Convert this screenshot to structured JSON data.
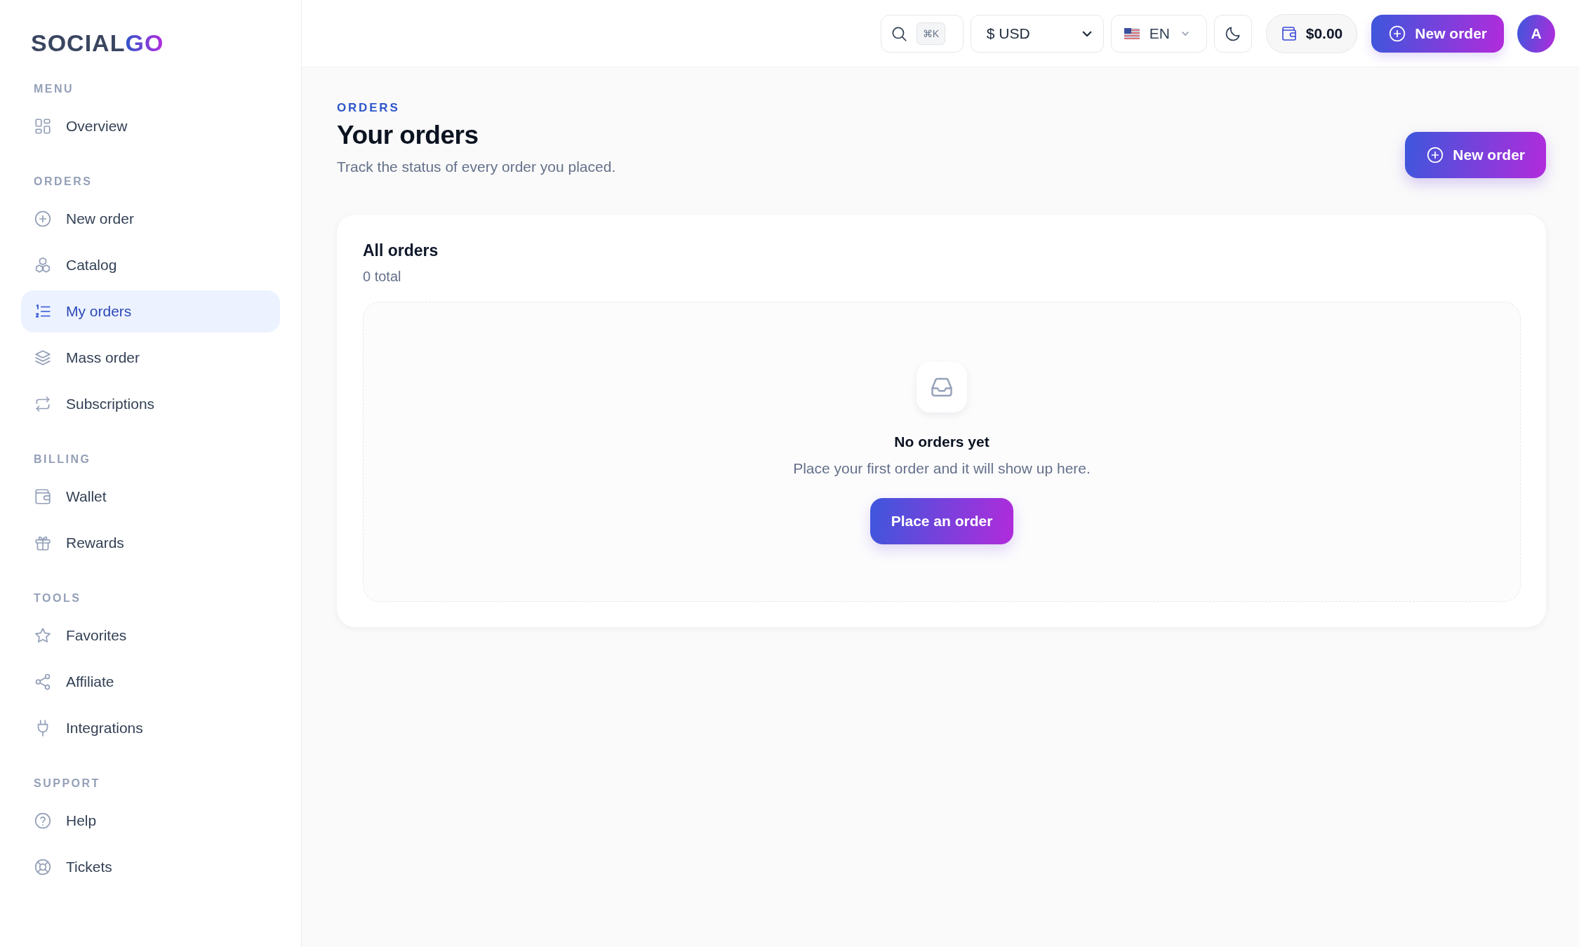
{
  "logo": {
    "primary": "SOCIAL",
    "accent": "GO"
  },
  "sidebar": {
    "sections": [
      {
        "label": "MENU",
        "items": [
          {
            "label": "Overview",
            "selected": false
          }
        ]
      },
      {
        "label": "ORDERS",
        "items": [
          {
            "label": "New order",
            "selected": false
          },
          {
            "label": "Catalog",
            "selected": false
          },
          {
            "label": "My orders",
            "selected": true
          },
          {
            "label": "Mass order",
            "selected": false
          },
          {
            "label": "Subscriptions",
            "selected": false
          }
        ]
      },
      {
        "label": "BILLING",
        "items": [
          {
            "label": "Wallet",
            "selected": false
          },
          {
            "label": "Rewards",
            "selected": false
          }
        ]
      },
      {
        "label": "TOOLS",
        "items": [
          {
            "label": "Favorites",
            "selected": false
          },
          {
            "label": "Affiliate",
            "selected": false
          },
          {
            "label": "Integrations",
            "selected": false
          }
        ]
      },
      {
        "label": "SUPPORT",
        "items": [
          {
            "label": "Help",
            "selected": false
          },
          {
            "label": "Tickets",
            "selected": false
          }
        ]
      }
    ]
  },
  "top_bar": {
    "search_shortcut": "⌘K",
    "currency": "$ USD",
    "language": "EN",
    "balance": "$0.00",
    "new_order": "New order",
    "avatar": "A"
  },
  "header": {
    "eyebrow": "ORDERS",
    "title": "Your orders",
    "subtitle": "Track the status of every order you placed.",
    "new_order": "New order"
  },
  "orders_card": {
    "title": "All orders",
    "count": "0 total",
    "empty_state": {
      "title": "No orders yet",
      "message": "Place your first order and it will show up here.",
      "button": "Place an order"
    }
  }
}
